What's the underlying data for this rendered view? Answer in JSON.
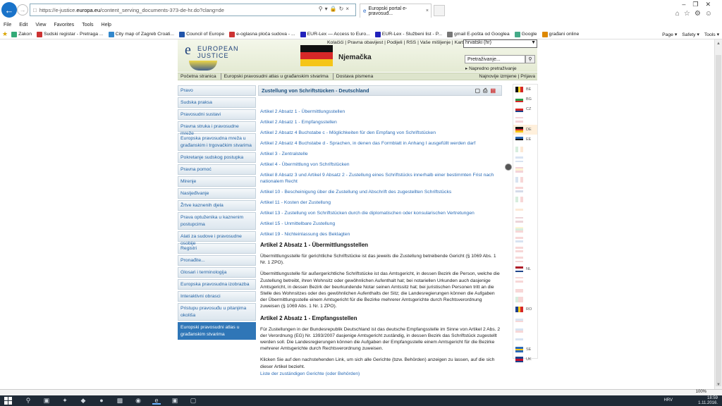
{
  "browser": {
    "url_prefix": "https://e-justice.",
    "url_host": "europa.eu",
    "url_rest": "/content_serving_documents-373-de-hr.do?clang=de",
    "tab_title": "Europski portal e-pravosuđ...",
    "menu": [
      "File",
      "Edit",
      "View",
      "Favorites",
      "Tools",
      "Help"
    ],
    "favorites": [
      {
        "label": "Zakon",
        "color": "#3a7"
      },
      {
        "label": "Sudski registar - Pretraga ...",
        "color": "#c33"
      },
      {
        "label": "City map of Zagreb Croati...",
        "color": "#38c"
      },
      {
        "label": "Council of Europe",
        "color": "#25a"
      },
      {
        "label": "e-oglasna ploča sudova - ...",
        "color": "#c33"
      },
      {
        "label": "EUR-Lex — Access to Euro...",
        "color": "#22b"
      },
      {
        "label": "EUR-Lex - Službeni list - P...",
        "color": "#22b"
      },
      {
        "label": "gmail E-pošta od Googlea",
        "color": "#777"
      },
      {
        "label": "Google",
        "color": "#4a8"
      },
      {
        "label": "građani online",
        "color": "#d80"
      }
    ],
    "tools": [
      "Page ▾",
      "Safety ▾",
      "Tools ▾"
    ],
    "zoom": "100%"
  },
  "site": {
    "logo_l1": "EUROPEAN",
    "logo_l2": "JUSTICE",
    "country": "Njemačka",
    "toplinks": "Kolačići | Pravna obavijest | Podijeli | RSS | Vaše mišljenje | Karta web-mjesta",
    "language": "hrvatski (hr)",
    "search_placeholder": "Pretraživanje...",
    "advanced_search": "▸ Napredno pretraživanje",
    "breadcrumbs": [
      "Početna stranica",
      "Europski pravosudni atlas u građanskim stvarima",
      "Dostava pismena"
    ],
    "right_links": "Najnovije izmjene  |  Prijava"
  },
  "leftnav": [
    {
      "label": "Pravo",
      "double": false,
      "active": false
    },
    {
      "label": "Sudska praksa",
      "double": false,
      "active": false
    },
    {
      "label": "Pravosudni sustavi",
      "double": false,
      "active": false
    },
    {
      "label": "Pravna struka i pravosudne mreže",
      "double": false,
      "active": false
    },
    {
      "label": "Europska pravosudna mreža u građanskim i trgovačkim stvarima",
      "double": true,
      "active": false
    },
    {
      "label": "Pokretanje sudskog postupka",
      "double": false,
      "active": false
    },
    {
      "label": "Pravna pomoć",
      "double": false,
      "active": false
    },
    {
      "label": "Mirenje",
      "double": false,
      "active": false
    },
    {
      "label": "Nasljeđivanje",
      "double": false,
      "active": false
    },
    {
      "label": "Žrtve kaznenih djela",
      "double": false,
      "active": false
    },
    {
      "label": "Prava optuženika u kaznenim postupcima",
      "double": true,
      "active": false
    },
    {
      "label": "Alati za sudove i pravosudne osobije",
      "double": false,
      "active": false
    },
    {
      "label": "Registri",
      "double": false,
      "active": false
    },
    {
      "label": "Pronađite...",
      "double": false,
      "active": false
    },
    {
      "label": "Glosari i terminologija",
      "double": false,
      "active": false
    },
    {
      "label": "Europska pravosudna izobrazba",
      "double": false,
      "active": false
    },
    {
      "label": "Interaktivni obrasci",
      "double": false,
      "active": false
    },
    {
      "label": "Pristupu pravosuđu u pitanjima okoliša",
      "double": true,
      "active": false
    },
    {
      "label": "Europski pravosudni atlas u građanskim stvarima",
      "double": true,
      "active": true
    }
  ],
  "content": {
    "heading": "Zustellung von Schriftstücken - Deutschland",
    "toc": [
      "Artikel 2 Absatz 1 - Übermittlungsstellen",
      "Artikel 2 Absatz 1 - Empfangsstellen",
      "Artikel 2 Absatz 4 Buchstabe c - Möglichkeiten für den Empfang von Schriftstücken",
      "Artikel 2 Absatz 4 Buchstabe d - Sprachen, in denen das Formblatt in Anhang I ausgefüllt werden darf",
      "Artikel 3 - Zentralstelle",
      "Artikel 4 - Übermittlung von Schriftstücken",
      "Artikel 8 Absatz 3 und Artikel 9 Absatz 2 - Zustellung eines Schriftstücks innerhalb einer bestimmten Frist nach nationalem Recht",
      "Artikel 10 - Bescheinigung über die Zustellung und Abschrift des zugestellten Schriftstücks",
      "Artikel 11 - Kosten der Zustellung",
      "Artikel 13 - Zustellung von Schriftstücken durch die diplomatischen oder konsularischen Vertretungen",
      "Artikel 15 - Unmittelbare Zustellung",
      "Artikel 19 - Nichteinlassung des Beklagten"
    ],
    "sec1_title": "Artikel 2 Absatz 1 - Übermittlungsstellen",
    "sec1_p1": "Übermittlungsstelle für gerichtliche Schriftstücke ist das jeweils die Zustellung betreibende Gericht (§ 1069 Abs. 1 Nr. 1 ZPO).",
    "sec1_p2": "Übermittlungsstelle für außergerichtliche Schriftstücke ist das Amtsgericht, in dessen Bezirk die Person, welche die Zustellung betreibt, ihren Wohnsitz oder gewöhnlichen Aufenthalt hat; bei notariellen Urkunden auch dasjenige Amtsgericht, in dessen Bezirk der beurkundende Notar seinen Amtssitz hat; bei juristischen Personen tritt an die Stelle des Wohnsitzes oder des gewöhnlichen Aufenthalts der Sitz; die Landesregierungen können die Aufgaben der Übermittlungsstelle einem Amtsgericht für die Bezirke mehrerer Amtsgerichte durch Rechtsverordnung zuweisen (§ 1069 Abs. 1 Nr. 1 ZPO).",
    "sec2_title": "Artikel 2 Absatz 1 - Empfangsstellen",
    "sec2_p1": "Für Zustellungen in der Bundesrepublik Deutschland ist das deutsche Empfangsstelle im Sinne von Artikel 2 Abs. 2 der Verordnung (EG) Nr. 1393/2007 dasjenige Amtsgericht zuständig, in dessen Bezirk das Schriftstück zugestellt werden soll. Die Landesregierungen können die Aufgaben der Empfangsstelle einem Amtsgericht für die Bezirke mehrerer Amtsgerichte durch Rechtsverordnung zuweisen.",
    "sec2_p2": "Klicken Sie auf den nachstehenden Link, um sich alle Gerichte (bzw. Behörden) anzeigen zu lassen, auf die sich dieser Artikel bezieht.",
    "sec2_link": "Liste der zuständigen Gerichte (oder Behörden)"
  },
  "flags": [
    {
      "code": "BE",
      "colors": [
        "#111",
        "#f5d020",
        "#d62828"
      ],
      "vertical": true,
      "state": "normal"
    },
    {
      "code": "BG",
      "colors": [
        "#fff",
        "#2a9d4a",
        "#d62828"
      ],
      "vertical": false,
      "state": "normal"
    },
    {
      "code": "CZ",
      "colors": [
        "#fff",
        "#d62828",
        "#1c3f8c"
      ],
      "vertical": false,
      "state": "normal"
    },
    {
      "code": "",
      "colors": [
        "#c8102e",
        "#fff",
        "#c8102e"
      ],
      "vertical": false,
      "state": "dim"
    },
    {
      "code": "DE",
      "colors": [
        "#111",
        "#d62828",
        "#f5c518"
      ],
      "vertical": false,
      "state": "sel"
    },
    {
      "code": "EE",
      "colors": [
        "#2d6ab8",
        "#111",
        "#fff"
      ],
      "vertical": false,
      "state": "normal"
    },
    {
      "code": "",
      "colors": [
        "#2a9d4a",
        "#fff",
        "#f08a24"
      ],
      "vertical": true,
      "state": "dim"
    },
    {
      "code": "",
      "colors": [
        "#2d6ab8",
        "#fff",
        "#2d6ab8"
      ],
      "vertical": false,
      "state": "dim"
    },
    {
      "code": "",
      "colors": [
        "#c8102e",
        "#f5c518",
        "#c8102e"
      ],
      "vertical": false,
      "state": "dim"
    },
    {
      "code": "",
      "colors": [
        "#2d6ab8",
        "#fff",
        "#d62828"
      ],
      "vertical": true,
      "state": "dim"
    },
    {
      "code": "",
      "colors": [
        "#d62828",
        "#fff",
        "#1c3f8c"
      ],
      "vertical": false,
      "state": "dim"
    },
    {
      "code": "",
      "colors": [
        "#2a9d4a",
        "#fff",
        "#d62828"
      ],
      "vertical": true,
      "state": "dim"
    },
    {
      "code": "",
      "colors": [
        "#fff",
        "#f08a24",
        "#fff"
      ],
      "vertical": false,
      "state": "dim"
    },
    {
      "code": "",
      "colors": [
        "#9e1b32",
        "#fff",
        "#9e1b32"
      ],
      "vertical": false,
      "state": "dim"
    },
    {
      "code": "",
      "colors": [
        "#f5c518",
        "#2a9d4a",
        "#d62828"
      ],
      "vertical": false,
      "state": "dim"
    },
    {
      "code": "",
      "colors": [
        "#d62828",
        "#fff",
        "#2d6ab8"
      ],
      "vertical": false,
      "state": "dim"
    },
    {
      "code": "",
      "colors": [
        "#d62828",
        "#fff",
        "#d62828"
      ],
      "vertical": false,
      "state": "dim"
    },
    {
      "code": "",
      "colors": [
        "#d62828",
        "#fff",
        "#d62828"
      ],
      "vertical": false,
      "state": "dim"
    },
    {
      "code": "NL",
      "colors": [
        "#ae1c28",
        "#fff",
        "#21468b"
      ],
      "vertical": false,
      "state": "normal"
    },
    {
      "code": "",
      "colors": [
        "#d62828",
        "#fff",
        "#d62828"
      ],
      "vertical": false,
      "state": "dim"
    },
    {
      "code": "",
      "colors": [
        "#fff",
        "#d62828",
        "#d62828"
      ],
      "vertical": false,
      "state": "dim"
    },
    {
      "code": "",
      "colors": [
        "#2a9d4a",
        "#d62828",
        "#d62828"
      ],
      "vertical": true,
      "state": "dim"
    },
    {
      "code": "RO",
      "colors": [
        "#1c3f8c",
        "#f5c518",
        "#d62828"
      ],
      "vertical": true,
      "state": "normal"
    },
    {
      "code": "",
      "colors": [
        "#fff",
        "#2d6ab8",
        "#d62828"
      ],
      "vertical": false,
      "state": "dim"
    },
    {
      "code": "",
      "colors": [
        "#fff",
        "#2d6ab8",
        "#d62828"
      ],
      "vertical": false,
      "state": "dim"
    },
    {
      "code": "",
      "colors": [
        "#fff",
        "#2d6ab8",
        "#fff"
      ],
      "vertical": false,
      "state": "dim"
    },
    {
      "code": "SE",
      "colors": [
        "#2d6ab8",
        "#f5c518",
        "#2d6ab8"
      ],
      "vertical": false,
      "state": "normal"
    },
    {
      "code": "UK",
      "colors": [
        "#1c3f8c",
        "#c8102e",
        "#1c3f8c"
      ],
      "vertical": false,
      "state": "normal"
    }
  ],
  "taskbar": {
    "lang": "HRV",
    "time": "18:59",
    "date": "1.11.2016."
  }
}
